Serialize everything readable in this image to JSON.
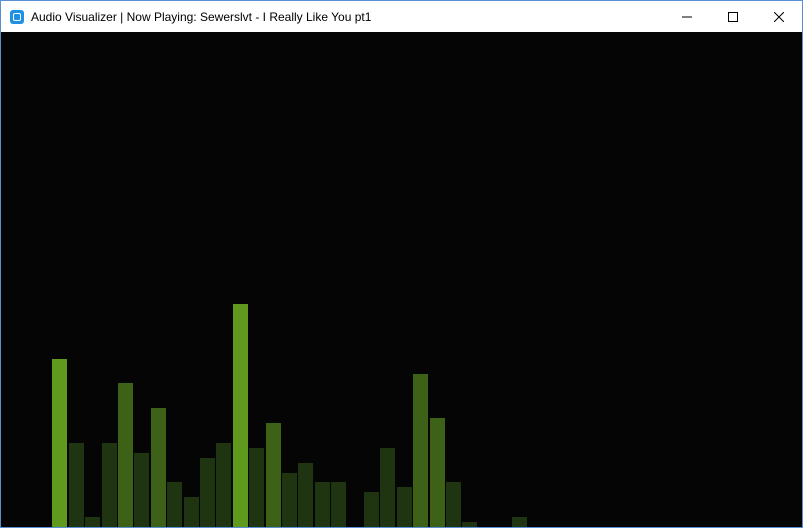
{
  "window": {
    "title": "Audio Visualizer | Now Playing: Sewerslvt - I Really Like You pt1",
    "app_icon": "app-icon",
    "controls": [
      {
        "name": "minimize-button",
        "icon": "minimize-icon"
      },
      {
        "name": "maximize-button",
        "icon": "maximize-icon"
      },
      {
        "name": "close-button",
        "icon": "close-icon"
      }
    ]
  },
  "visualizer": {
    "background_color": "#050505",
    "bar_levels": [
      0.0,
      0.34,
      0.17,
      0.02,
      0.17,
      0.29,
      0.15,
      0.24,
      0.09,
      0.06,
      0.14,
      0.17,
      0.45,
      0.16,
      0.21,
      0.11,
      0.13,
      0.09,
      0.09,
      0.0,
      0.07,
      0.16,
      0.08,
      0.31,
      0.22,
      0.09,
      0.01,
      0.0,
      0.0,
      0.02
    ],
    "colors": {
      "bright": "#5f9a1e",
      "mid": "#3d6117",
      "dim": "#1f3410"
    }
  }
}
